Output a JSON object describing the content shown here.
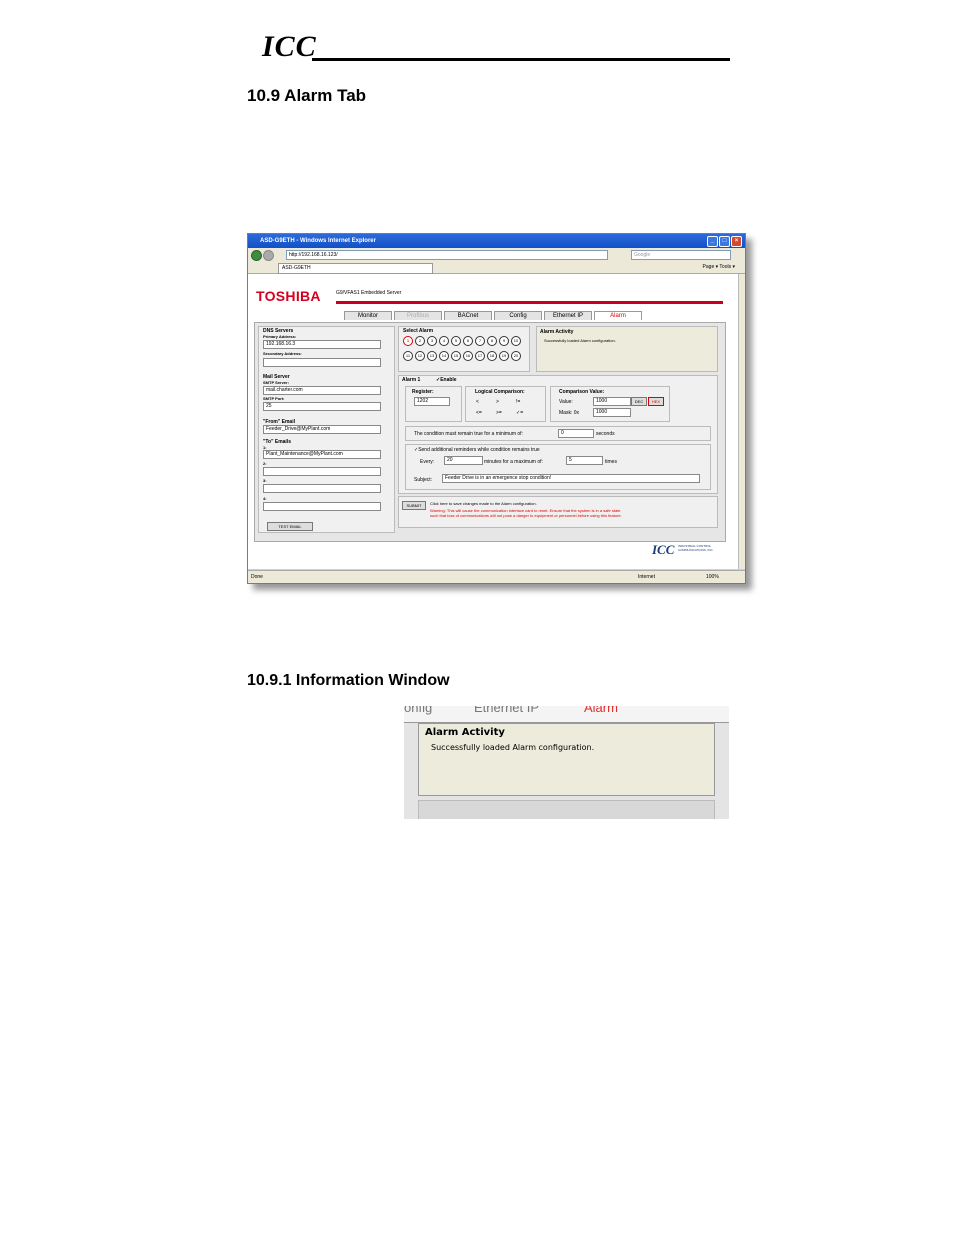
{
  "header": {
    "logo_text": "ICC"
  },
  "section_alarm": {
    "heading": "10.9  Alarm Tab"
  },
  "section_info": {
    "heading": "10.9.1  Information Window"
  },
  "browser": {
    "window_title": "ASD-G9ETH - Windows Internet Explorer",
    "address": "http://192.168.16.123/",
    "search_placeholder": "Google",
    "tab_title": "ASD-G9ETH",
    "tools_label": "Page ▾  Tools ▾",
    "status_left": "Done",
    "zone": "Internet",
    "zoom": "100%"
  },
  "app": {
    "brand": "TOSHIBA",
    "server_title": "G9/VFAS1 Embedded Server",
    "tabs": [
      "Monitor",
      "Profibus",
      "BACnet",
      "Config",
      "Ethernet IP",
      "Alarm"
    ],
    "dns": {
      "title": "DNS Servers",
      "primary_label": "Primary Address:",
      "primary_value": "192.168.16.3",
      "secondary_label": "Secondary Address:",
      "secondary_value": ""
    },
    "mail": {
      "title": "Mail Server",
      "smtp_server_label": "SMTP Server:",
      "smtp_server_value": "mail.charter.com",
      "smtp_port_label": "SMTP Port:",
      "smtp_port_value": "25"
    },
    "from": {
      "title": "\"From\" Email",
      "value": "Feeder_Drive@MyPlant.com"
    },
    "to": {
      "title": "\"To\" Emails",
      "labels": [
        "1:",
        "2:",
        "3:",
        "4:"
      ],
      "values": [
        "Plant_Maintenance@MyPlant.com",
        "",
        "",
        ""
      ]
    },
    "test_email_button": "TEST EMAIL",
    "select_alarm": {
      "title": "Select Alarm",
      "numbers": [
        "1",
        "2",
        "3",
        "4",
        "5",
        "6",
        "7",
        "8",
        "9",
        "10",
        "11",
        "12",
        "13",
        "14",
        "15",
        "16",
        "17",
        "18",
        "19",
        "20"
      ]
    },
    "activity": {
      "title": "Alarm Activity",
      "message": "Successfully loaded Alarm configuration."
    },
    "alarm_config": {
      "alarm_label": "Alarm 1",
      "enable_label": "✓Enable",
      "register_label": "Register:",
      "register_value": "1202",
      "logical_label": "Logical Comparison:",
      "logical_options": [
        "<",
        ">",
        "!=",
        "<=",
        ">=",
        "✓="
      ],
      "comparison_label": "Comparison Value:",
      "value_label": "Value:",
      "value_value": "1000",
      "mask_label": "Mask: 0x",
      "mask_value": "1000",
      "dec_button": "DEC",
      "hex_button": "HEX",
      "condition_prefix": "The condition must remain true for a minimum of:",
      "condition_value": "0",
      "condition_suffix": "seconds",
      "reminder_label": "✓Send additional reminders while condition remains true",
      "every_label": "Every:",
      "every_value": "20",
      "minutes_label": "minutes for a maximum of:",
      "max_value": "5",
      "times_label": "times",
      "subject_label": "Subject:",
      "subject_value": "Feeder Drive is in an emergence stop condition!"
    },
    "submit": {
      "button": "SUBMIT",
      "info": "Click here to save changes made to the Alarm configuration.",
      "warning_1": "Warning: This will cause the communication interface card to reset. Ensure that the system is in a safe state",
      "warning_2": "such that loss of communications will not pose a danger to equipment or personnel before using this feature."
    },
    "footer_logo": "ICC",
    "footer_text": "INDUSTRIAL CONTROL COMMUNICATIONS, INC."
  },
  "zoom": {
    "tabs": [
      "onfig",
      "Ethernet IP",
      "Alarm"
    ],
    "title": "Alarm Activity",
    "message": "Successfully loaded Alarm configuration."
  }
}
